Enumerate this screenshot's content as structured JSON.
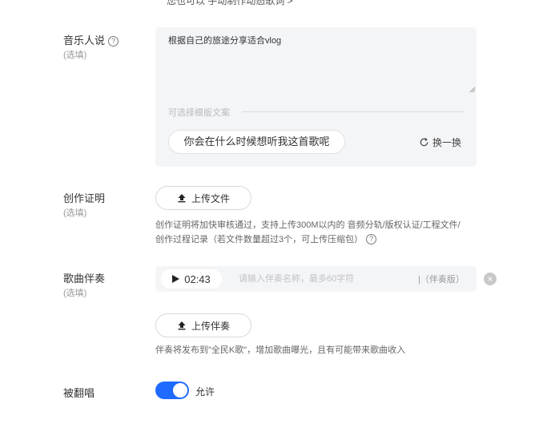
{
  "top_hint": "您也可以 手动制作动态歌词 >",
  "music_says": {
    "label": "音乐人说",
    "optional": "(选填)",
    "text": "根据自己的旅途分享适合vlog",
    "template_label": "可选择模版文案",
    "template_option": "你会在什么时候想听我这首歌呢",
    "refresh_label": "换一换",
    "help_icon": "question-circle-icon"
  },
  "proof": {
    "label": "创作证明",
    "optional": "(选填)",
    "upload_label": "上传文件",
    "desc_line1": "创作证明将加快审核通过，支持上传300M以内的 音频分轨/版权认证/工程文件/",
    "desc_line2": "创作过程记录（若文件数量超过3个，可上传压缩包）"
  },
  "accompaniment": {
    "label": "歌曲伴奏",
    "optional": "(选填)",
    "duration": "02:43",
    "name_placeholder": "请输入伴奏名称，最多60字符",
    "tag": "|（伴奏版）",
    "upload_label": "上传伴奏",
    "desc": "伴奏将发布到\"全民K歌\"，增加歌曲曝光，且有可能带来歌曲收入"
  },
  "cover": {
    "label": "被翻唱",
    "toggle_on": true,
    "toggle_label": "允许",
    "accent": "#1f6bff"
  }
}
